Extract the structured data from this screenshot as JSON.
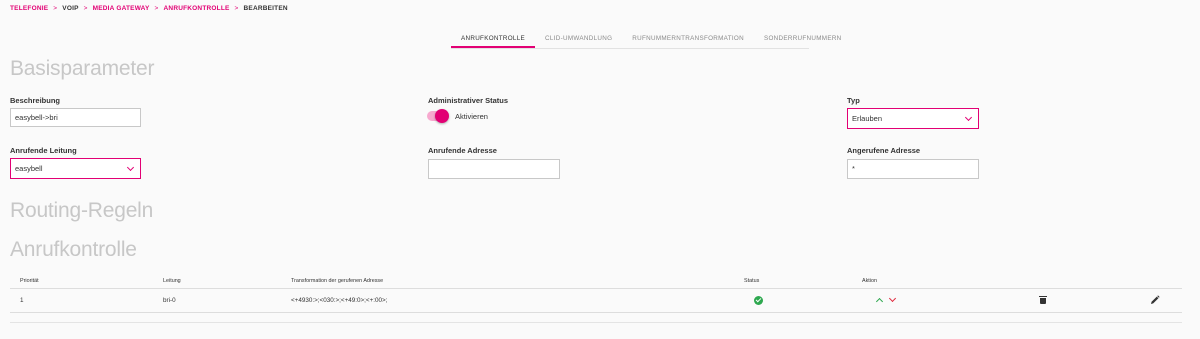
{
  "breadcrumb": {
    "items": [
      {
        "label": "TELEFONIE",
        "link": true
      },
      {
        "label": "VOIP",
        "link": false
      },
      {
        "label": "MEDIA GATEWAY",
        "link": true
      },
      {
        "label": "ANRUFKONTROLLE",
        "link": true
      },
      {
        "label": "BEARBEITEN",
        "link": false
      }
    ],
    "separator": ">"
  },
  "tabs": [
    {
      "label": "ANRUFKONTROLLE",
      "active": true
    },
    {
      "label": "CLID-UMWANDLUNG",
      "active": false
    },
    {
      "label": "RUFNUMMERNTRANSFORMATION",
      "active": false
    },
    {
      "label": "SONDERRUFNUMMERN",
      "active": false
    }
  ],
  "sections": {
    "basis": "Basisparameter",
    "routing": "Routing-Regeln",
    "anrufkontrolle": "Anrufkontrolle"
  },
  "form": {
    "beschreibung": {
      "label": "Beschreibung",
      "value": "easybell->bri"
    },
    "admin_status": {
      "label": "Administrativer Status",
      "toggle_label": "Aktivieren",
      "enabled": true
    },
    "typ": {
      "label": "Typ",
      "value": "Erlauben"
    },
    "anrufende_leitung": {
      "label": "Anrufende Leitung",
      "value": "easybell"
    },
    "anrufende_adresse": {
      "label": "Anrufende Adresse",
      "value": ""
    },
    "angerufene_adresse": {
      "label": "Angerufene Adresse",
      "value": "*"
    }
  },
  "table": {
    "headers": {
      "prioritaet": "Priorität",
      "leitung": "Leitung",
      "transformation": "Transformation der gerufenen Adresse",
      "status": "Status",
      "aktion": "Aktion"
    },
    "rows": [
      {
        "prioritaet": "1",
        "leitung": "bri-0",
        "transformation": "<+4930:>;<030:>;<+49:0>;<+:00>;",
        "status": "ok"
      }
    ]
  },
  "colors": {
    "accent": "#e20074",
    "ok": "#2ea84f",
    "down": "#e0283c"
  },
  "icons": [
    "check-circle-icon",
    "arrow-up-icon",
    "arrow-down-icon",
    "trash-icon",
    "pencil-icon",
    "chevron-down-icon"
  ]
}
